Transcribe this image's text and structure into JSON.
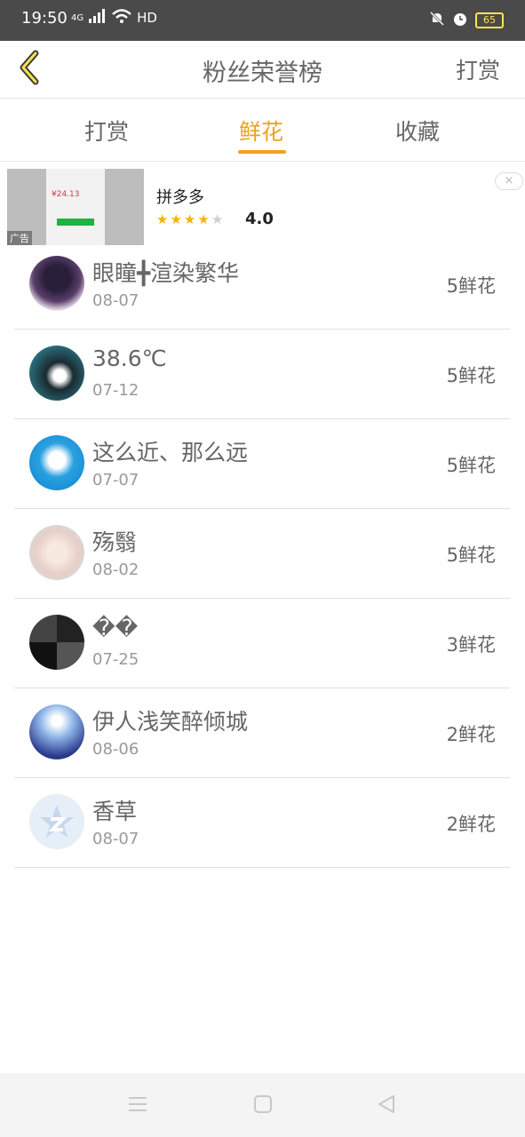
{
  "status_bar": {
    "time": "19:50",
    "network": "4G",
    "hd": "HD",
    "battery": "65"
  },
  "header": {
    "title": "粉丝荣誉榜",
    "action": "打赏"
  },
  "tabs": [
    {
      "label": "打赏"
    },
    {
      "label": "鲜花"
    },
    {
      "label": "收藏"
    }
  ],
  "active_tab": "鲜花",
  "ad": {
    "app_name": "拼多多",
    "rating": "4.0",
    "stars": 4,
    "price": "¥24.13",
    "tag": "广告",
    "close": "×"
  },
  "list": [
    {
      "name": "眼瞳╋渲染繁华",
      "date": "08-07",
      "amount": "5鲜花"
    },
    {
      "name": "38.6℃",
      "date": "07-12",
      "amount": "5鲜花"
    },
    {
      "name": "这么近、那么远",
      "date": "07-07",
      "amount": "5鲜花"
    },
    {
      "name": "殇翳",
      "date": "08-02",
      "amount": "5鲜花"
    },
    {
      "name": "��",
      "date": "07-25",
      "amount": "3鲜花"
    },
    {
      "name": "伊人浅笑醉倾城",
      "date": "08-06",
      "amount": "2鲜花"
    },
    {
      "name": "香草",
      "date": "08-07",
      "amount": "2鲜花"
    }
  ],
  "colors": {
    "accent": "#f0a020",
    "status_bar": "#4a4a4a",
    "battery": "#ffe34d"
  }
}
